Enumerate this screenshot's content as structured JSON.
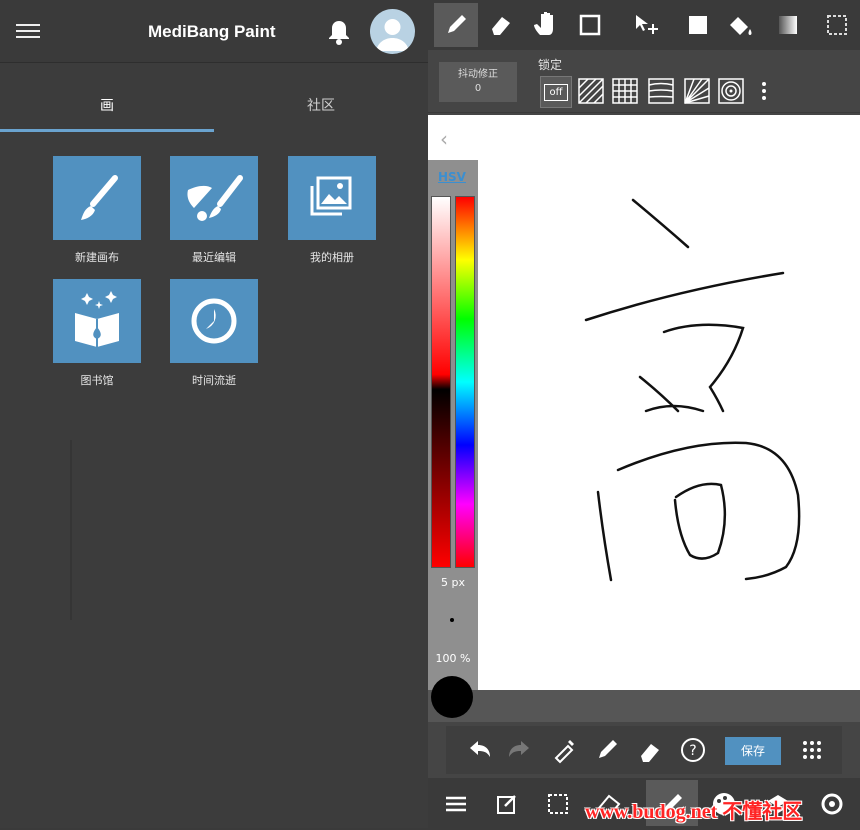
{
  "header": {
    "title": "MediBang Paint"
  },
  "tabs": [
    {
      "label": "画"
    },
    {
      "label": "社区"
    }
  ],
  "tiles": [
    {
      "label": "新建画布",
      "icon": "brush-icon"
    },
    {
      "label": "最近编辑",
      "icon": "brushes-icon"
    },
    {
      "label": "我的相册",
      "icon": "gallery-icon"
    },
    {
      "label": "图书馆",
      "icon": "book-icon"
    },
    {
      "label": "时间流逝",
      "icon": "timelapse-icon"
    }
  ],
  "editor": {
    "stabilizer": {
      "label": "抖动修正",
      "value": "0"
    },
    "lock_label": "锁定",
    "ruler_off": "off",
    "color_mode": "HSV",
    "brush_size": "5 px",
    "opacity": "100 %",
    "save_label": "保存",
    "colors": {
      "accent": "#5191c0",
      "current": "#000000"
    }
  },
  "watermark": "www.budog.net 不懂社区"
}
